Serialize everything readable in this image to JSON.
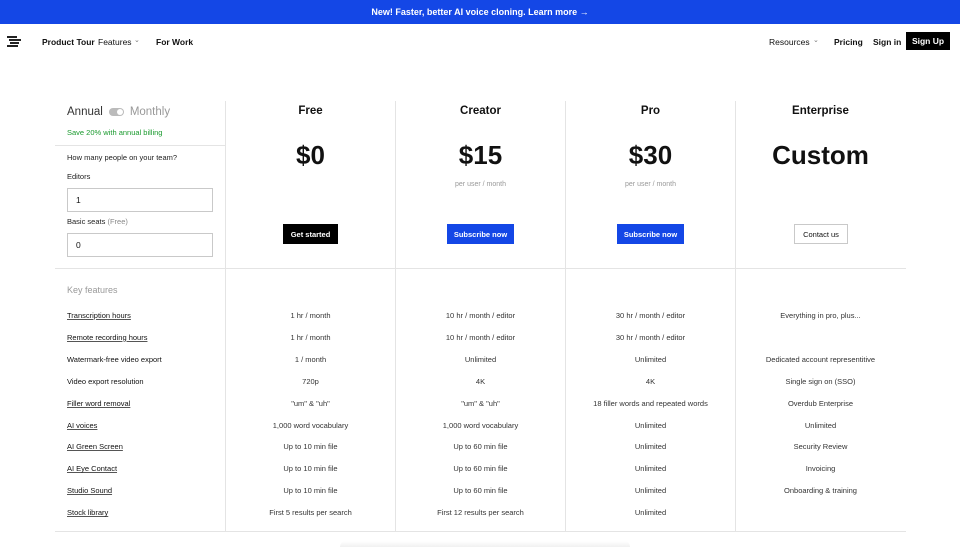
{
  "banner": {
    "text": "New! Faster, better AI voice cloning. Learn more →"
  },
  "nav": {
    "left": [
      "Product Tour",
      "Features",
      "For Work"
    ],
    "resources": "Resources",
    "pricing": "Pricing",
    "signin": "Sign in",
    "signup": "Sign Up"
  },
  "billing": {
    "annual": "Annual",
    "monthly": "Monthly",
    "save_note": "Save 20% with annual billing",
    "team_question": "How many people on your team?",
    "editors_label": "Editors",
    "editors_value": "1",
    "basic_label": "Basic seats",
    "basic_note": "(Free)",
    "basic_value": "0"
  },
  "plans": [
    {
      "name": "Free",
      "price": "$0",
      "per": "",
      "cta": "Get started"
    },
    {
      "name": "Creator",
      "price": "$15",
      "per": "per user / month",
      "cta": "Subscribe now"
    },
    {
      "name": "Pro",
      "price": "$30",
      "per": "per user / month",
      "cta": "Subscribe now"
    },
    {
      "name": "Enterprise",
      "price": "Custom",
      "per": "",
      "cta": "Contact us"
    }
  ],
  "features": {
    "heading": "Key features",
    "rows": [
      {
        "name": "Transcription hours",
        "values": [
          "1 hr / month",
          "10 hr / month / editor",
          "30 hr / month / editor",
          "Everything in pro, plus..."
        ]
      },
      {
        "name": "Remote recording hours",
        "values": [
          "1 hr / month",
          "10 hr / month / editor",
          "30 hr / month / editor",
          ""
        ]
      },
      {
        "name": "Watermark-free video export",
        "values": [
          "1 / month",
          "Unlimited",
          "Unlimited",
          "Dedicated account representitive"
        ]
      },
      {
        "name": "Video export resolution",
        "values": [
          "720p",
          "4K",
          "4K",
          "Single sign on (SSO)"
        ]
      },
      {
        "name": "Filler word removal",
        "values": [
          "\"um\" & \"uh\"",
          "\"um\" & \"uh\"",
          "18 filler words and repeated words",
          "Overdub Enterprise"
        ]
      },
      {
        "name": "AI voices",
        "values": [
          "1,000 word vocabulary",
          "1,000 word vocabulary",
          "Unlimited",
          "Unlimited"
        ]
      },
      {
        "name": "AI Green Screen",
        "values": [
          "Up to 10 min file",
          "Up to 60 min file",
          "Unlimited",
          "Security Review"
        ]
      },
      {
        "name": "AI Eye Contact",
        "values": [
          "Up to 10 min file",
          "Up to 60 min file",
          "Unlimited",
          "Invoicing"
        ]
      },
      {
        "name": "Studio Sound",
        "values": [
          "Up to 10 min file",
          "Up to 60 min file",
          "Unlimited",
          "Onboarding & training"
        ]
      },
      {
        "name": "Stock library",
        "values": [
          "First 5 results per search",
          "First 12 results per search",
          "Unlimited",
          ""
        ]
      }
    ]
  }
}
